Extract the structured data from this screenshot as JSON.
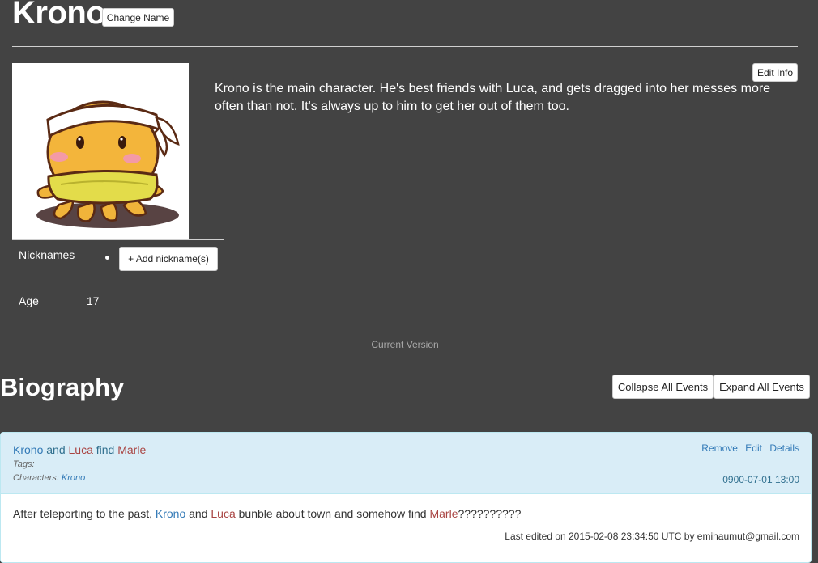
{
  "header": {
    "title": "Krono",
    "change_name_label": "Change Name"
  },
  "info": {
    "edit_label": "Edit Info",
    "description": "Krono is the main character. He's best friends with Luca, and gets dragged into her messes more often than not. It's always up to him to get her out of them too."
  },
  "attributes": {
    "nicknames_label": "Nicknames",
    "add_nickname_label": "+ Add nickname(s)",
    "age_label": "Age",
    "age_value": "17"
  },
  "version_text": "Current Version",
  "biography": {
    "title": "Biography",
    "collapse_label": "Collapse All Events",
    "expand_label": "Expand All Events"
  },
  "event": {
    "title_parts": [
      "Krono",
      " and ",
      "Luca",
      " find ",
      "Marle"
    ],
    "tags_label": "Tags:",
    "characters_label": "Characters:",
    "characters_value": "Krono",
    "actions": [
      "Remove",
      "Edit",
      "Details"
    ],
    "date": "0900-07-01 13:00",
    "body_parts": [
      "After teleporting to the past, ",
      "Krono",
      " and ",
      "Luca",
      " bunble about town and somehow find ",
      "Marle",
      "??????????"
    ],
    "last_edited": "Last edited on 2015-02-08 23:34:50 UTC by emihaumut@gmail.com"
  },
  "colors": {
    "background": "#434343",
    "character_blue": "#337ab7",
    "character_red": "#a94442",
    "event_header": "#d9edf7"
  },
  "icons": {
    "avatar": "octopus-mascot-image"
  }
}
